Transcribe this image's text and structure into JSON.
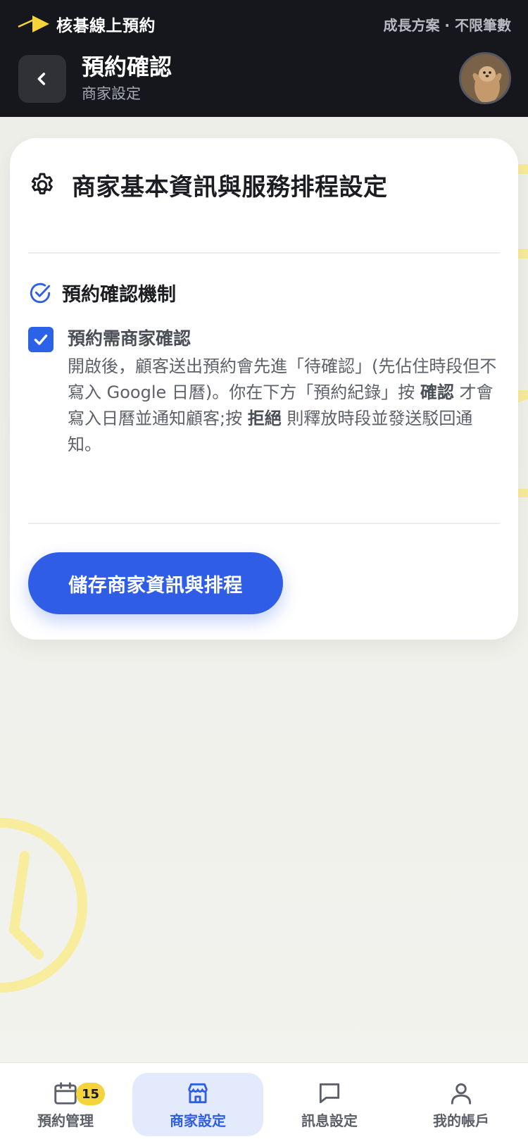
{
  "app": {
    "name": "核碁線上預約",
    "plan": "成長方案 · 不限筆數"
  },
  "header": {
    "title": "預約確認",
    "subtitle": "商家設定"
  },
  "card": {
    "title": "商家基本資訊與服務排程設定",
    "section_title": "預約確認機制",
    "checkbox": {
      "label": "預約需商家確認",
      "checked": true,
      "desc_1": "開啟後，顧客送出預約會先進「待確認」(先佔住時段但不寫入 Google 日曆)。你在下方「預約紀錄」按 ",
      "desc_confirm": "確認",
      "desc_2": " 才會寫入日曆並通知顧客;按 ",
      "desc_reject": "拒絕",
      "desc_3": " 則釋放時段並發送駁回通知。"
    },
    "save_label": "儲存商家資訊與排程"
  },
  "nav": {
    "items": [
      {
        "label": "預約管理",
        "icon": "calendar-icon",
        "badge": "15",
        "active": false
      },
      {
        "label": "商家設定",
        "icon": "store-icon",
        "active": true
      },
      {
        "label": "訊息設定",
        "icon": "message-icon",
        "active": false
      },
      {
        "label": "我的帳戶",
        "icon": "user-icon",
        "active": false
      }
    ]
  },
  "colors": {
    "header_bg": "#15171c",
    "accent": "#2f5de6",
    "badge": "#f4d43a"
  }
}
